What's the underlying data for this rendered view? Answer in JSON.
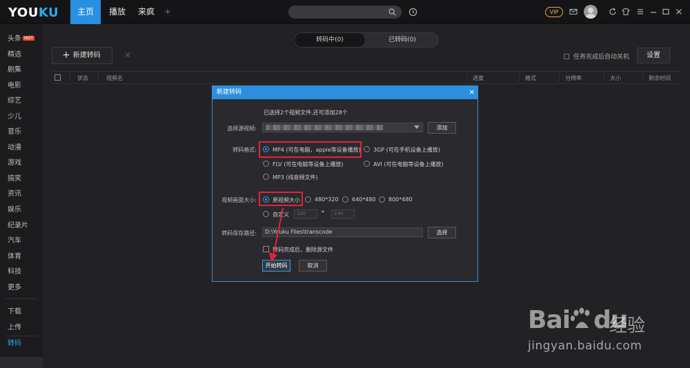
{
  "topbar": {
    "logo_you": "YOU",
    "logo_ku": "KU",
    "tabs": [
      {
        "label": "主页",
        "active": true
      },
      {
        "label": "播放",
        "active": false
      },
      {
        "label": "来疯",
        "active": false
      }
    ],
    "add_tab": "+",
    "vip": "VIP"
  },
  "sidebar": {
    "items": [
      {
        "label": "头条",
        "badge": "HOT"
      },
      {
        "label": "精选"
      },
      {
        "label": "剧集"
      },
      {
        "label": "电影"
      },
      {
        "label": "综艺"
      },
      {
        "label": "少儿"
      },
      {
        "label": "音乐"
      },
      {
        "label": "动漫"
      },
      {
        "label": "游戏"
      },
      {
        "label": "搞笑"
      },
      {
        "label": "资讯"
      },
      {
        "label": "娱乐"
      },
      {
        "label": "纪录片"
      },
      {
        "label": "汽车"
      },
      {
        "label": "体育"
      },
      {
        "label": "科技"
      },
      {
        "label": "更多"
      }
    ],
    "bottom": [
      {
        "label": "下载"
      },
      {
        "label": "上传"
      },
      {
        "label": "转码",
        "active": true
      }
    ]
  },
  "main": {
    "segments": [
      "转码中(0)",
      "已转码(0)"
    ],
    "new_button": "新建转码",
    "new_plus": "+",
    "close": "✕",
    "auto_shutdown": "任务完成后自动关机",
    "settings": "设置",
    "columns": [
      "状态",
      "视频名",
      "进度",
      "格式",
      "分辨率",
      "大小",
      "剩余时间"
    ]
  },
  "dialog": {
    "title": "新建转码",
    "close": "✕",
    "info": "已选择2个视频文件,还可添加28个",
    "source_label": "选择源视频:",
    "add": "添加",
    "format_label": "转码格式:",
    "formats": [
      "MP4 (可在电脑，apple等设备播放)",
      "3GP (可在手机设备上播放)",
      "FLV (可在电脑等设备上播放)",
      "AVI (可在电脑等设备上播放)",
      "MP3 (纯音频文件)"
    ],
    "size_label": "视频画面大小:",
    "sizes": [
      "原视频大小",
      "480*320",
      "640*480",
      "800*480"
    ],
    "custom": "自定义",
    "custom_w": "320",
    "custom_h": "240",
    "times": "*",
    "path_label": "转码保存路径:",
    "path": "D:\\Youku Files\\transcode",
    "choose": "选择",
    "delete_src": "转码完成后，删除源文件",
    "start": "开始转码",
    "cancel": "取消"
  },
  "watermark": {
    "bai": "Bai",
    "du": "du",
    "jingyan": "经验",
    "url": "jingyan.baidu.com"
  }
}
